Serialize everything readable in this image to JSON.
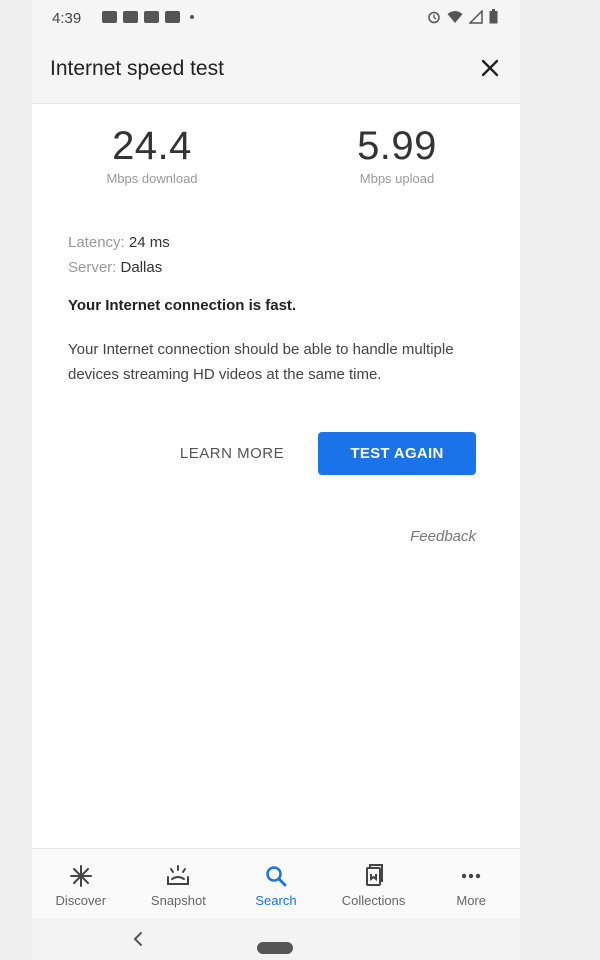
{
  "status_bar": {
    "time": "4:39",
    "notification_icons": [
      "messages-icon",
      "news-icon",
      "youtube-icon",
      "youtube-icon"
    ],
    "system_icons": [
      "alarm-icon",
      "wifi-icon",
      "signal-icon",
      "battery-icon"
    ]
  },
  "header": {
    "title": "Internet speed test",
    "close_icon": "close-icon"
  },
  "results": {
    "download_value": "24.4",
    "download_label": "Mbps download",
    "upload_value": "5.99",
    "upload_label": "Mbps upload",
    "latency_label": "Latency:",
    "latency_value": "24 ms",
    "server_label": "Server:",
    "server_value": "Dallas",
    "verdict": "Your Internet connection is fast.",
    "description": "Your Internet connection should be able to handle multiple devices streaming HD videos at the same time."
  },
  "actions": {
    "learn_more": "LEARN MORE",
    "test_again": "TEST AGAIN",
    "feedback": "Feedback"
  },
  "bottom_nav": {
    "items": [
      {
        "label": "Discover",
        "icon": "discover-icon"
      },
      {
        "label": "Snapshot",
        "icon": "snapshot-icon"
      },
      {
        "label": "Search",
        "icon": "search-icon",
        "active": true
      },
      {
        "label": "Collections",
        "icon": "collections-icon"
      },
      {
        "label": "More",
        "icon": "more-icon"
      }
    ]
  },
  "colors": {
    "accent": "#1a73e8",
    "text_primary": "#222222",
    "text_secondary": "#9a9a9a"
  }
}
